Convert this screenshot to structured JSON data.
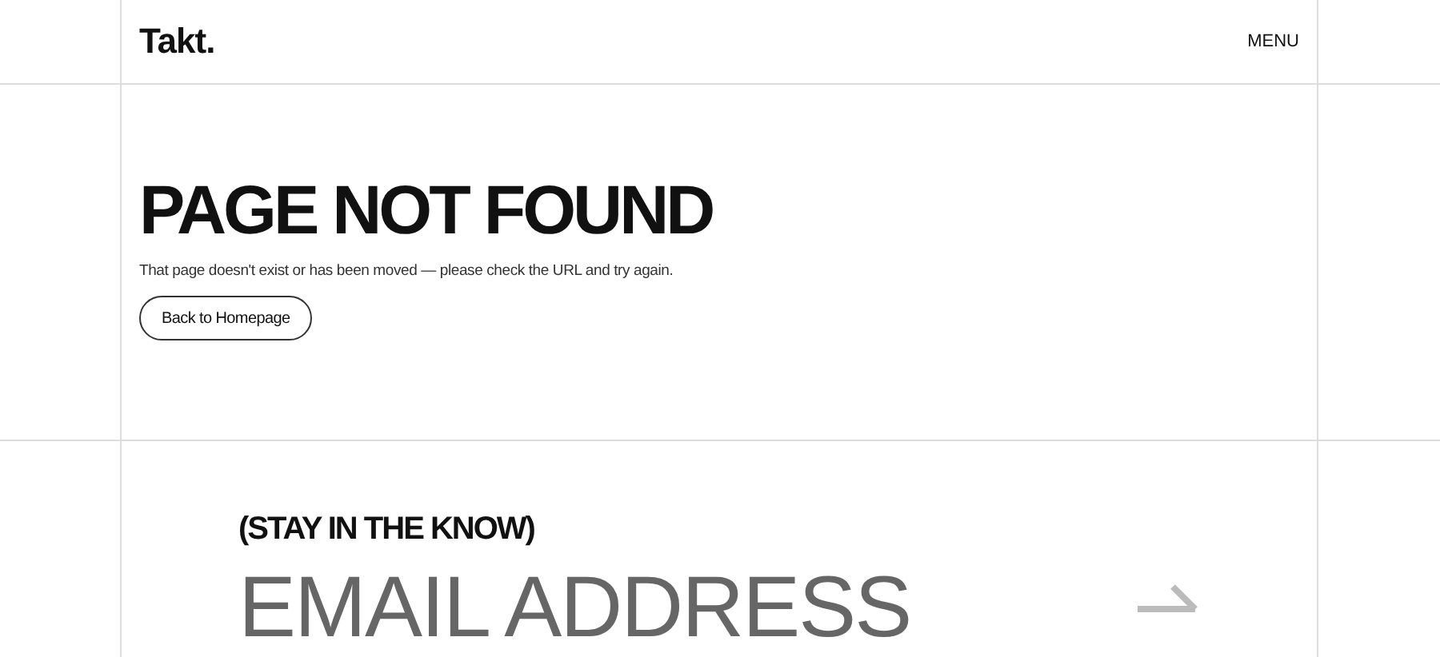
{
  "header": {
    "logo": "Takt.",
    "menu": "MENU"
  },
  "error": {
    "title": "PAGE NOT FOUND",
    "message": "That page doesn't exist or has been moved — please check the URL and try again.",
    "button": "Back to Homepage"
  },
  "newsletter": {
    "heading": "(STAY IN THE KNOW)",
    "email": {
      "placeholder": "EMAIL ADDRESS"
    }
  }
}
